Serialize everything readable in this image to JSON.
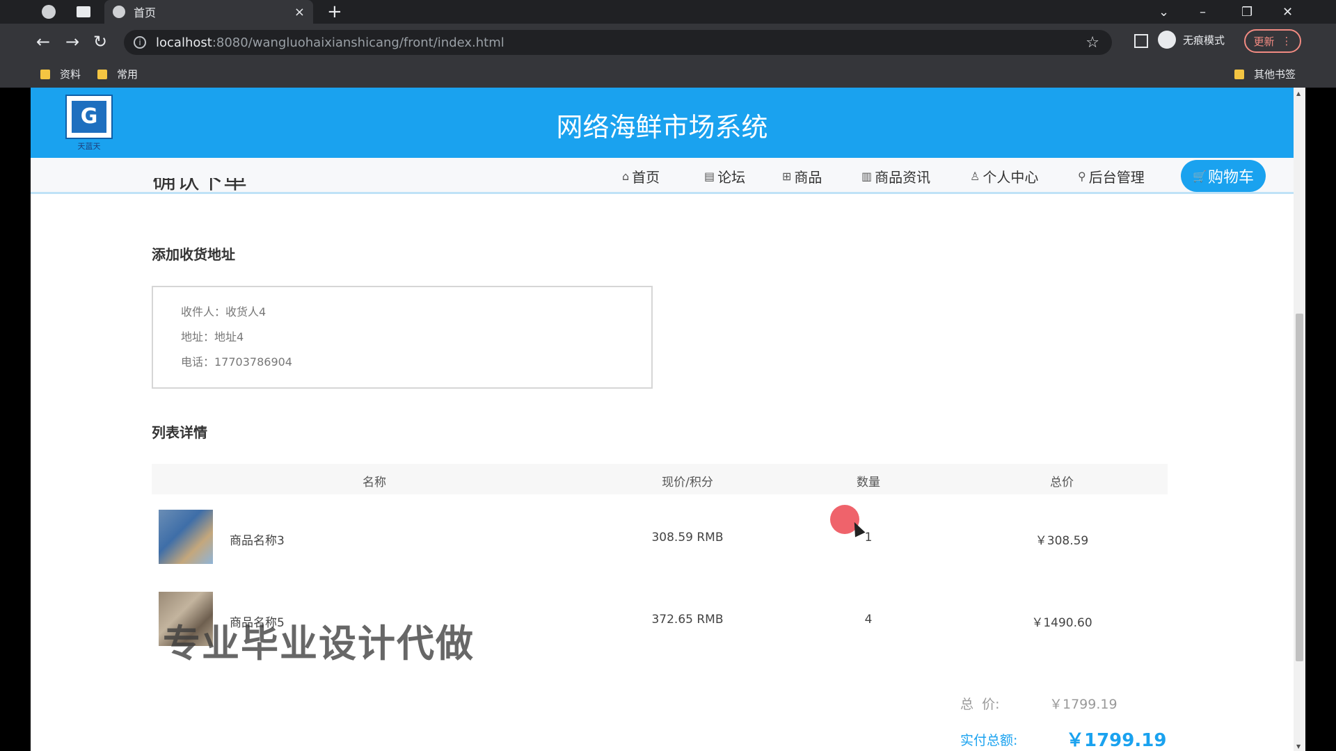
{
  "browser": {
    "tab_title": "首页",
    "tab_close": "×",
    "new_tab": "+",
    "url_host": "localhost",
    "url_rest": ":8080/wangluohaixianshicang/front/index.html",
    "incognito_label": "无痕模式",
    "update_label": "更新",
    "bookmarks": [
      "资料",
      "常用"
    ],
    "other_bookmarks": "其他书签"
  },
  "site": {
    "title": "网络海鲜市场系统",
    "logo_mark": "G",
    "logo_caption": "天蓝天"
  },
  "nav": {
    "items": [
      {
        "icon": "⌂",
        "label": "首页"
      },
      {
        "icon": "▤",
        "label": "论坛"
      },
      {
        "icon": "⊞",
        "label": "商品"
      },
      {
        "icon": "▥",
        "label": "商品资讯"
      },
      {
        "icon": "♙",
        "label": "个人中心"
      },
      {
        "icon": "⚲",
        "label": "后台管理"
      }
    ],
    "cart": {
      "icon": "🛒",
      "label": "购物车"
    }
  },
  "main": {
    "cut_title": "确认下单",
    "address_section": "添加收货地址",
    "address": {
      "recipient": "收件人：收货人4",
      "addr": "地址：地址4",
      "phone": "电话：17703786904"
    },
    "list_section": "列表详情",
    "columns": [
      "名称",
      "现价/积分",
      "数量",
      "总价"
    ],
    "rows": [
      {
        "name": "商品名称3",
        "price": "308.59 RMB",
        "qty": "1",
        "total": "￥308.59"
      },
      {
        "name": "商品名称5",
        "price": "372.65 RMB",
        "qty": "4",
        "total": "￥1490.60"
      }
    ],
    "watermark": "专业毕业设计代做",
    "summary": {
      "total_label": "总  价:",
      "total_value": "￥1799.19",
      "paid_label": "实付总额:",
      "paid_value": "￥1799.19"
    }
  }
}
